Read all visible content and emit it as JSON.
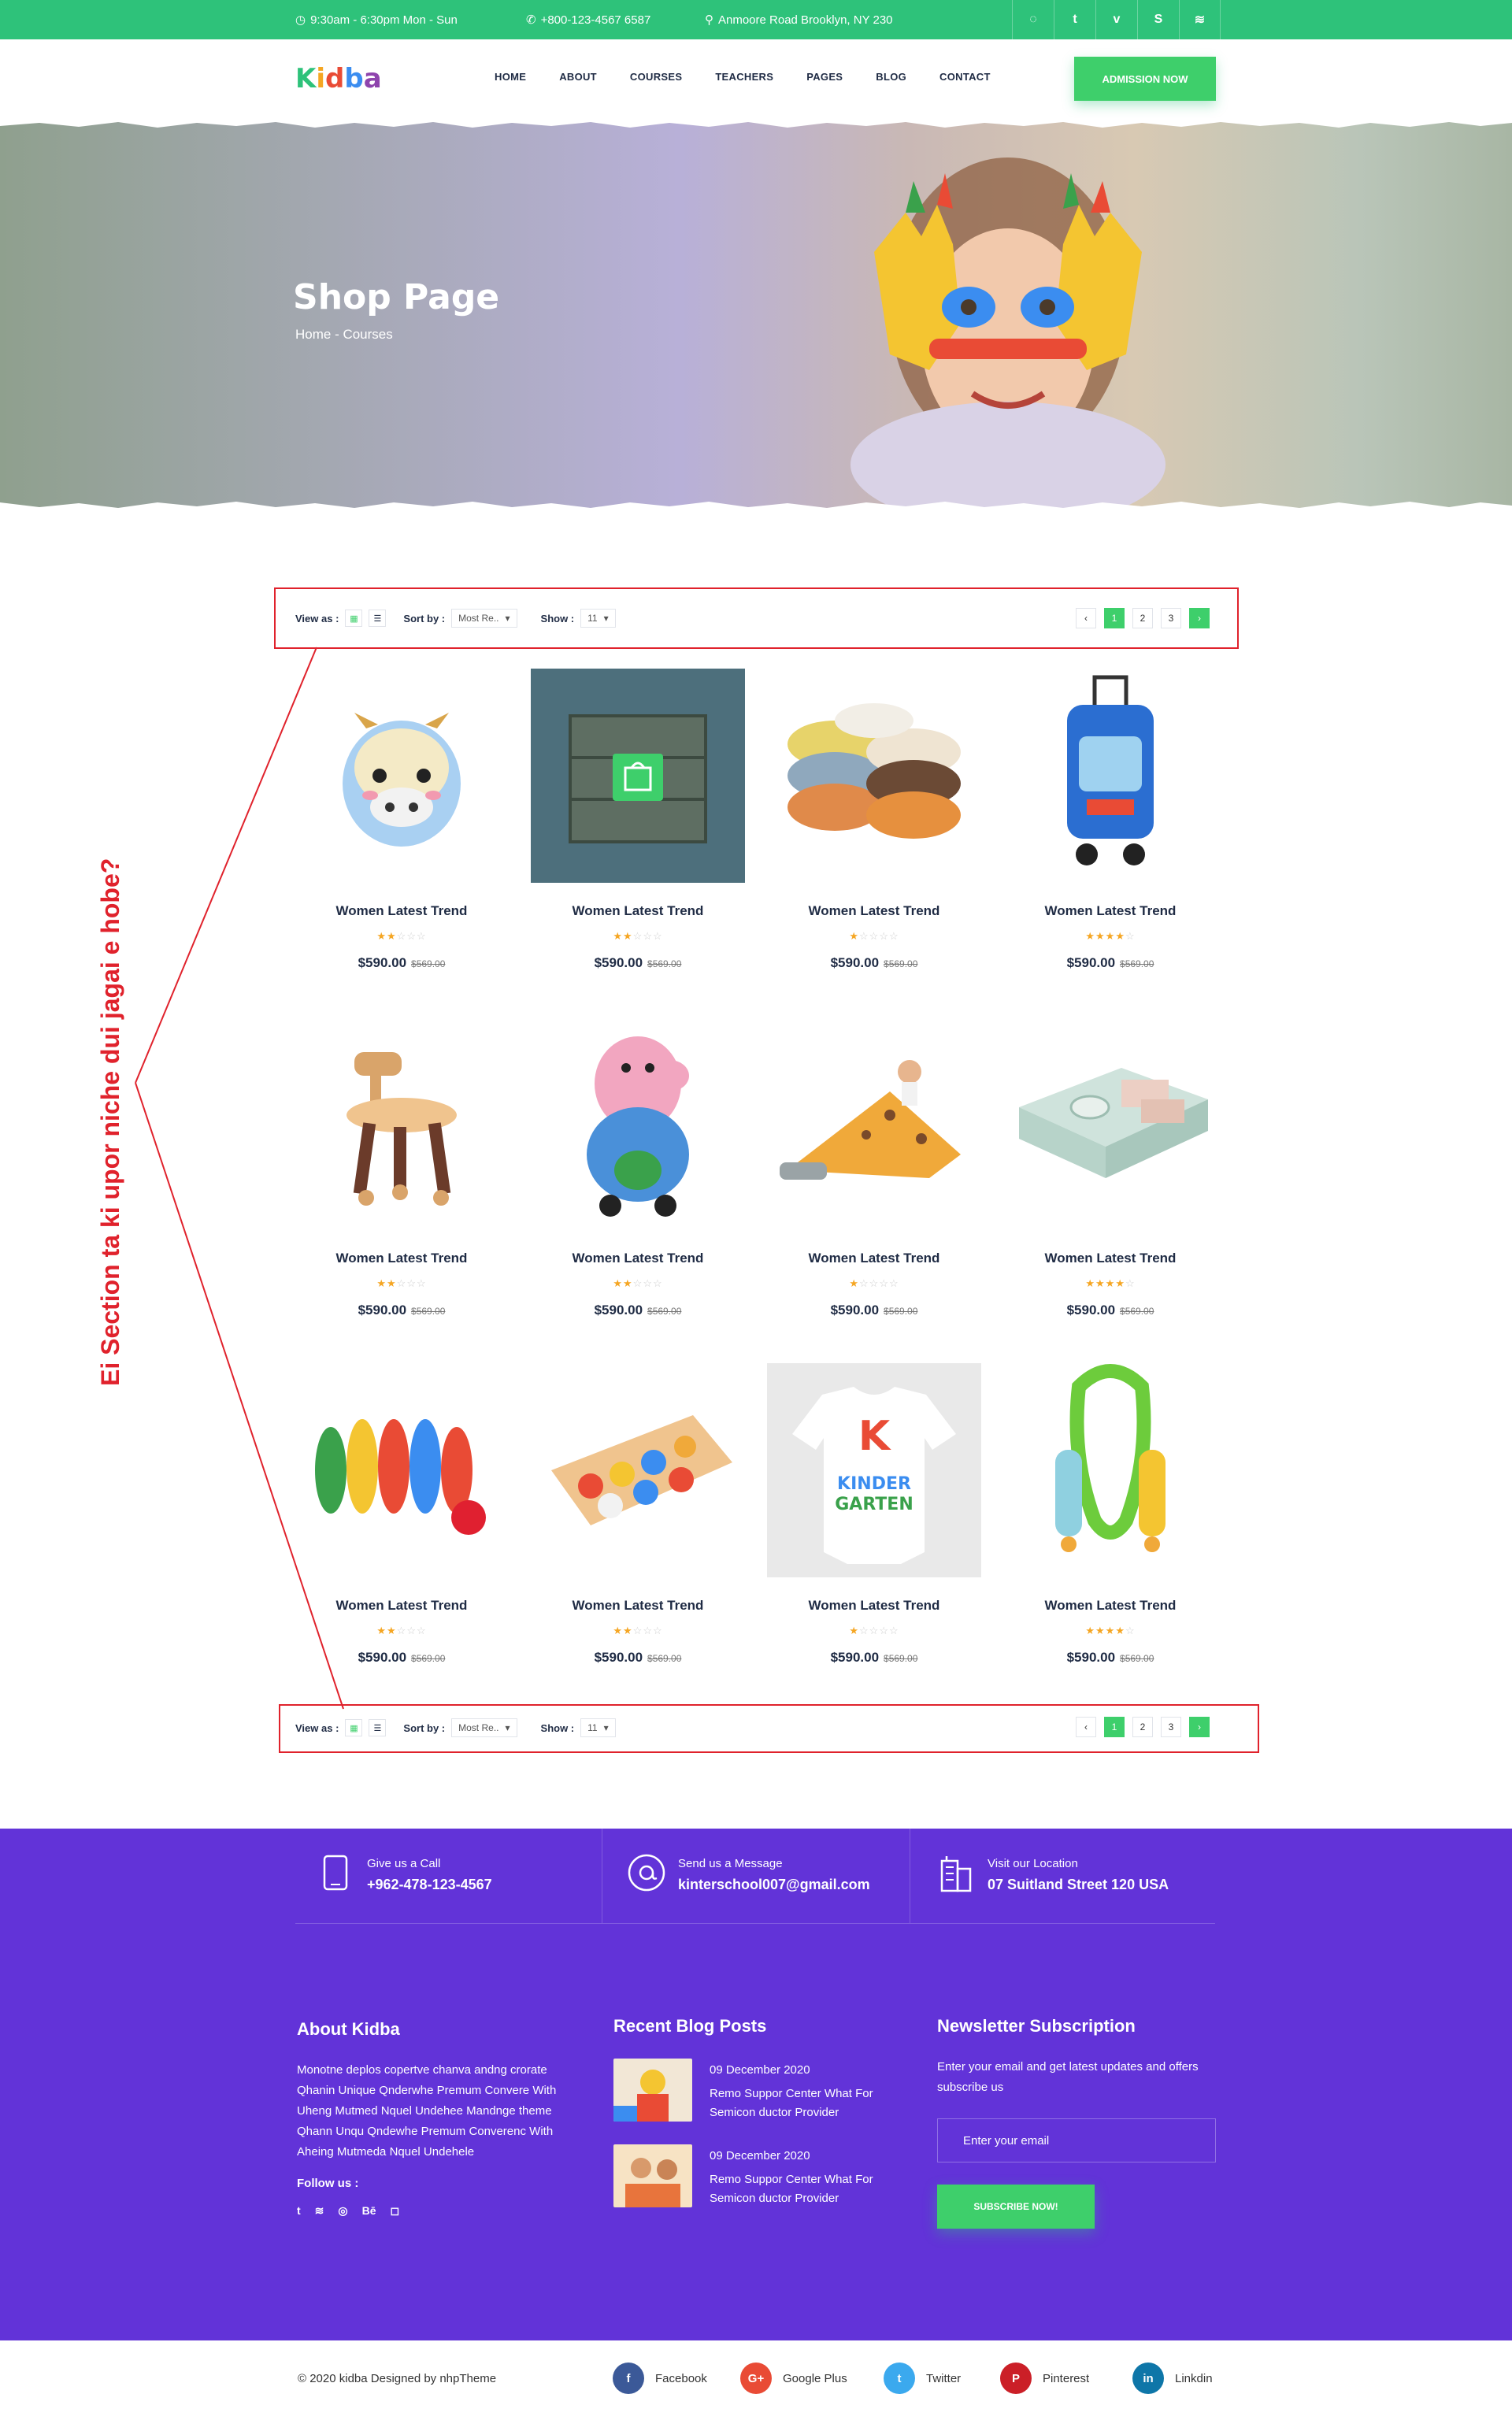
{
  "topbar": {
    "hours": "9:30am - 6:30pm Mon - Sun",
    "phone": "+800-123-4567 6587",
    "address": "Anmoore Road Brooklyn, NY 230",
    "socials": [
      "messenger-icon",
      "twitter-icon",
      "vimeo-icon",
      "skype-icon",
      "rss-icon"
    ]
  },
  "header": {
    "logo": [
      "K",
      "i",
      "d",
      "b",
      "a"
    ],
    "logo_colors": [
      "#2ec27a",
      "#f5a623",
      "#e94b35",
      "#3b8df0",
      "#8e44ad"
    ],
    "nav": [
      "HOME",
      "ABOUT",
      "COURSES",
      "TEACHERS",
      "PAGES",
      "BLOG",
      "CONTACT"
    ],
    "cta": "ADMISSION NOW"
  },
  "hero": {
    "title": "Shop Page",
    "breadcrumb": "Home - Courses"
  },
  "toolbar": {
    "view_label": "View as :",
    "sort_label": "Sort by :",
    "sort_value": "Most Re..",
    "show_label": "Show :",
    "show_value": "11",
    "pages": [
      "1",
      "2",
      "3"
    ],
    "prev": "‹",
    "next": "›"
  },
  "products": [
    {
      "name": "Women Latest Trend",
      "rating": 2,
      "price": "$590.00",
      "old_price": "$569.00",
      "image": "cow-backpack"
    },
    {
      "name": "Women Latest Trend",
      "rating": 2,
      "price": "$590.00",
      "old_price": "$569.00",
      "image": "shelf-cabinet"
    },
    {
      "name": "Women Latest Trend",
      "rating": 1,
      "price": "$590.00",
      "old_price": "$569.00",
      "image": "corner-guards"
    },
    {
      "name": "Women Latest Trend",
      "rating": 4,
      "price": "$590.00",
      "old_price": "$569.00",
      "image": "trolley-backpack"
    },
    {
      "name": "Women Latest Trend",
      "rating": 2,
      "price": "$590.00",
      "old_price": "$569.00",
      "image": "wooden-chair"
    },
    {
      "name": "Women Latest Trend",
      "rating": 2,
      "price": "$590.00",
      "old_price": "$569.00",
      "image": "peppa-plush"
    },
    {
      "name": "Women Latest Trend",
      "rating": 1,
      "price": "$590.00",
      "old_price": "$569.00",
      "image": "giraffe-slide"
    },
    {
      "name": "Women Latest Trend",
      "rating": 4,
      "price": "$590.00",
      "old_price": "$569.00",
      "image": "plate-set"
    },
    {
      "name": "Women Latest Trend",
      "rating": 2,
      "price": "$590.00",
      "old_price": "$569.00",
      "image": "bowling-set"
    },
    {
      "name": "Women Latest Trend",
      "rating": 2,
      "price": "$590.00",
      "old_price": "$569.00",
      "image": "shape-sorter"
    },
    {
      "name": "Women Latest Trend",
      "rating": 1,
      "price": "$590.00",
      "old_price": "$569.00",
      "image": "kinder-onesie"
    },
    {
      "name": "Women Latest Trend",
      "rating": 4,
      "price": "$590.00",
      "old_price": "$569.00",
      "image": "jump-rope"
    }
  ],
  "annotation": "Ei Section ta ki upor niche dui jagai e hobe?",
  "footer": {
    "contacts": [
      {
        "label": "Give us a Call",
        "value": "+962-478-123-4567",
        "icon": "phone-icon"
      },
      {
        "label": "Send us a Message",
        "value": "kinterschool007@gmail.com",
        "icon": "at-icon"
      },
      {
        "label": "Visit our Location",
        "value": "07 Suitland Street 120 USA",
        "icon": "building-icon"
      }
    ],
    "about": {
      "title": "About Kidba",
      "text": "Monotne deplos copertve chanva andng crorate Qhanin Unique Qnderwhe Premum Convere With Uheng Mutmed Nquel Undehee Mandnge theme Qhann Unqu Qndewhe Premum Converenc With Aheing Mutmeda Nquel Undehele",
      "follow": "Follow us :",
      "socials": [
        "twitter-icon",
        "rss-icon",
        "dribbble-icon",
        "behance-icon",
        "instagram-icon"
      ]
    },
    "blog": {
      "title": "Recent Blog Posts",
      "posts": [
        {
          "date": "09 December 2020",
          "title": "Remo Suppor Center What For Semicon ductor Provider"
        },
        {
          "date": "09 December 2020",
          "title": "Remo Suppor Center What For Semicon ductor Provider"
        }
      ]
    },
    "newsletter": {
      "title": "Newsletter Subscription",
      "text": "Enter your email and get latest updates and offers subscribe us",
      "placeholder": "Enter your email",
      "button": "SUBSCRIBE NOW!"
    }
  },
  "bottom": {
    "copyright": "© 2020 kidba Designed by nhpTheme",
    "socials": [
      {
        "label": "Facebook",
        "icon": "facebook-icon",
        "color": "#3b5998",
        "glyph": "f"
      },
      {
        "label": "Google Plus",
        "icon": "google-plus-icon",
        "color": "#e94b35",
        "glyph": "G+"
      },
      {
        "label": "Twitter",
        "icon": "twitter-icon",
        "color": "#3ba9ee",
        "glyph": "t"
      },
      {
        "label": "Pinterest",
        "icon": "pinterest-icon",
        "color": "#cb1f27",
        "glyph": "P"
      },
      {
        "label": "Linkdin",
        "icon": "linkedin-icon",
        "color": "#0e76a8",
        "glyph": "in"
      }
    ]
  }
}
